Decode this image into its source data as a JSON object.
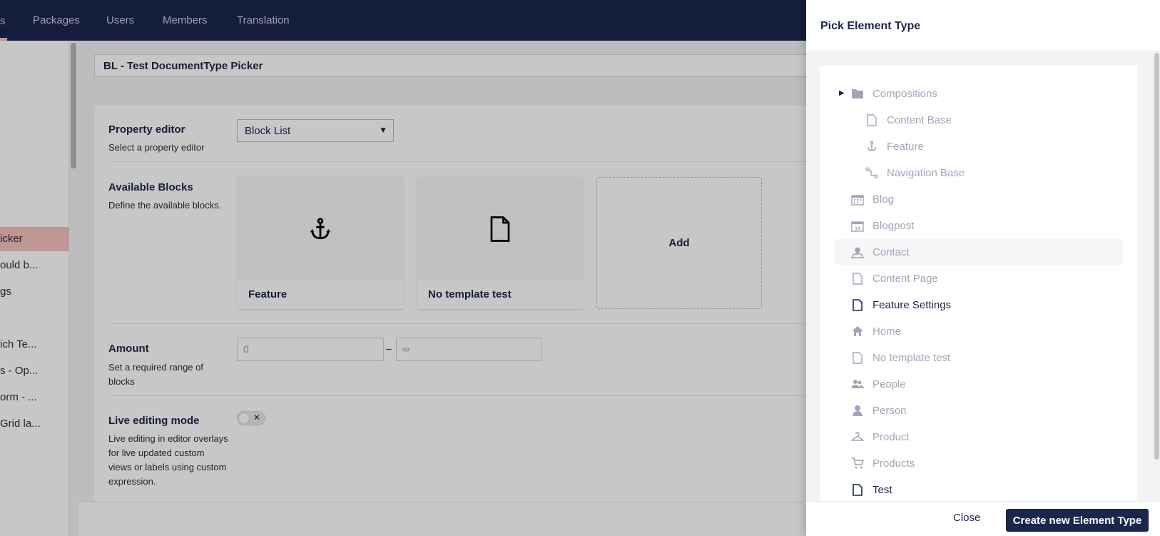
{
  "topnav": {
    "partial_item": "s",
    "items": [
      "Packages",
      "Users",
      "Members",
      "Translation"
    ]
  },
  "sidebar": {
    "items": [
      {
        "label": "icker",
        "active": true
      },
      {
        "label": "ould b..."
      },
      {
        "label": "gs"
      },
      {
        "label": "ich Te..."
      },
      {
        "label": "s - Op..."
      },
      {
        "label": "orm - ..."
      },
      {
        "label": "Grid la..."
      }
    ]
  },
  "editor": {
    "name": "BL - Test DocumentType Picker",
    "property_editor": {
      "label": "Property editor",
      "desc": "Select a property editor",
      "value": "Block List"
    },
    "available_blocks": {
      "label": "Available Blocks",
      "desc": "Define the available blocks.",
      "blocks": [
        "Feature",
        "No template test"
      ],
      "add_label": "Add"
    },
    "amount": {
      "label": "Amount",
      "desc": "Set a required range of blocks",
      "min_placeholder": "0",
      "max_placeholder": "∞",
      "separator": "–"
    },
    "live_editing": {
      "label": "Live editing mode",
      "desc": "Live editing in editor overlays for live updated custom views or labels using custom expression.",
      "toggle_state": "✕"
    }
  },
  "dialog": {
    "title": "Pick Element Type",
    "tree": [
      {
        "label": "Compositions",
        "icon": "folder-icon",
        "level": 0,
        "expandable": true
      },
      {
        "label": "Content Base",
        "icon": "document-icon",
        "level": 1
      },
      {
        "label": "Feature",
        "icon": "anchor-icon",
        "level": 1
      },
      {
        "label": "Navigation Base",
        "icon": "route-icon",
        "level": 1
      },
      {
        "label": "Blog",
        "icon": "calendar-icon",
        "level": 0
      },
      {
        "label": "Blogpost",
        "icon": "calendar-14-icon",
        "level": 0
      },
      {
        "label": "Contact",
        "icon": "map-pin-user-icon",
        "level": 0,
        "hover": true
      },
      {
        "label": "Content Page",
        "icon": "document-icon",
        "level": 0
      },
      {
        "label": "Feature Settings",
        "icon": "document-icon",
        "level": 0,
        "enabled": true
      },
      {
        "label": "Home",
        "icon": "home-icon",
        "level": 0
      },
      {
        "label": "No template test",
        "icon": "document-icon",
        "level": 0
      },
      {
        "label": "People",
        "icon": "users-icon",
        "level": 0
      },
      {
        "label": "Person",
        "icon": "user-icon",
        "level": 0
      },
      {
        "label": "Product",
        "icon": "hanger-icon",
        "level": 0
      },
      {
        "label": "Products",
        "icon": "cart-icon",
        "level": 0
      },
      {
        "label": "Test",
        "icon": "document-icon",
        "level": 0,
        "enabled": true
      }
    ],
    "calendar_day": "14",
    "close_label": "Close",
    "create_label": "Create new Element Type"
  }
}
